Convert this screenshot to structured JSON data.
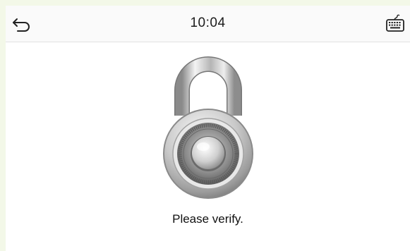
{
  "header": {
    "time": "10:04",
    "back_icon": "back-arrow-icon",
    "keyboard_icon": "keyboard-icon"
  },
  "main": {
    "graphic": "padlock-combination-icon",
    "prompt": "Please verify."
  },
  "colors": {
    "page_background": "#ffffff",
    "header_background": "#fafafa",
    "text": "#111111"
  }
}
